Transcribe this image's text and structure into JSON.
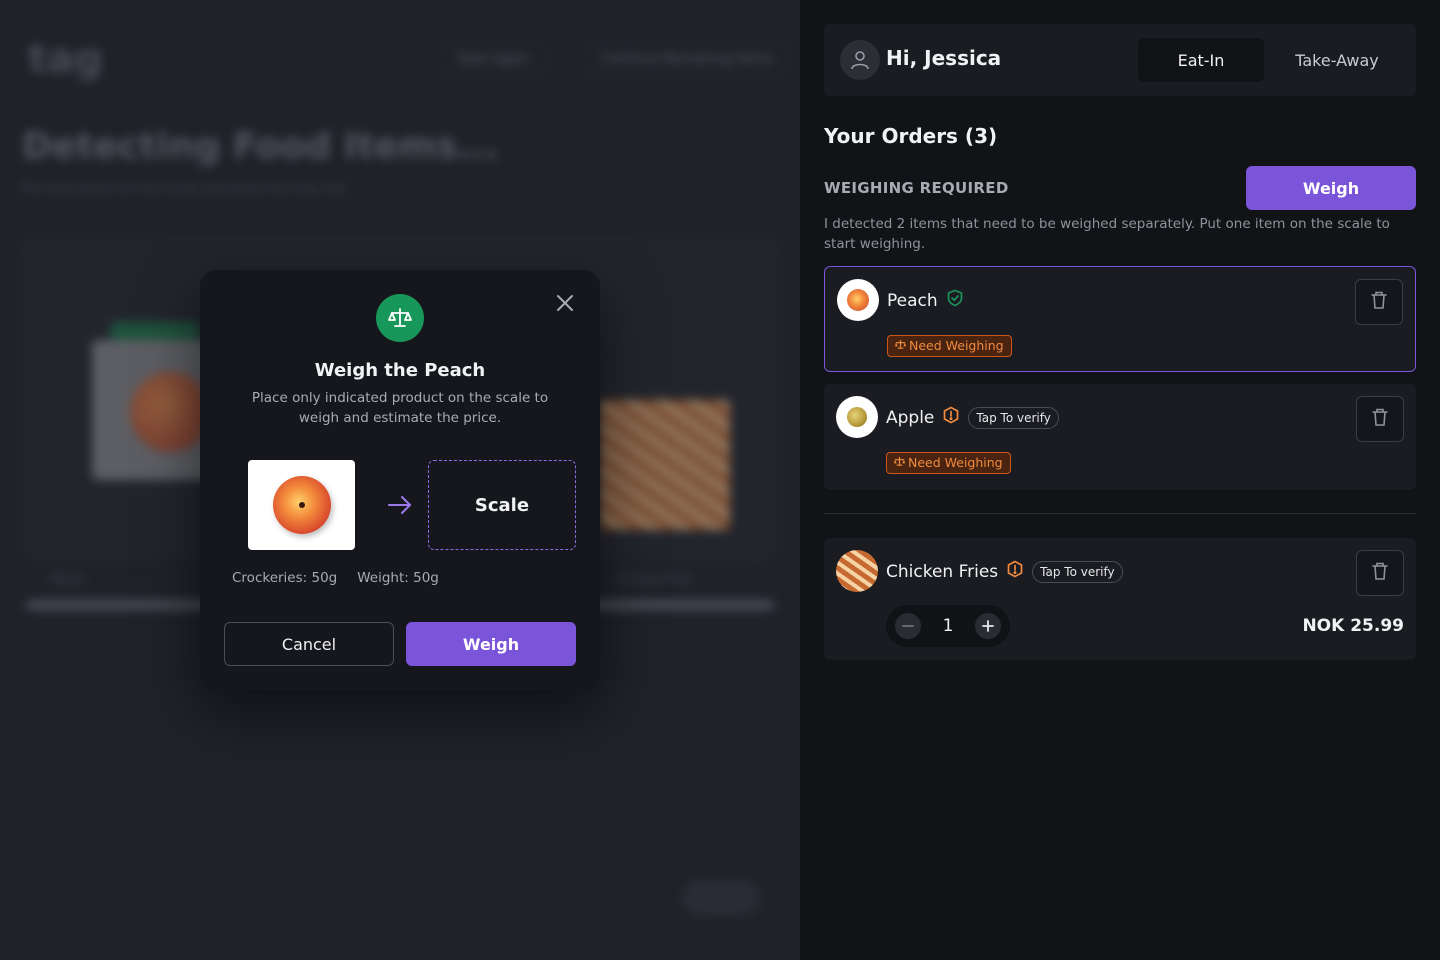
{
  "background": {
    "logo": "tag",
    "nav_pills": [
      "Start Again",
      "Continue Remaining Items"
    ],
    "title": "Detecting Food Items...",
    "subtitle": "Put food items on the scale and keep the tray still",
    "captions": [
      "Peach",
      "Chicken Fries"
    ],
    "help_button": "Help"
  },
  "modal": {
    "icon": "scale-icon",
    "title": "Weigh the Peach",
    "description": "Place only indicated product on the scale to weigh and estimate the price.",
    "scale_label": "Scale",
    "crockeries": "Crockeries: 50g",
    "weight": "Weight: 50g",
    "cancel_label": "Cancel",
    "weigh_label": "Weigh"
  },
  "header": {
    "greeting": "Hi, Jessica",
    "modes": [
      {
        "label": "Eat-In",
        "active": true
      },
      {
        "label": "Take-Away",
        "active": false
      }
    ]
  },
  "orders": {
    "title": "Your Orders (3)",
    "weighing_section": {
      "label": "WEIGHING REQUIRED",
      "weigh_button": "Weigh",
      "description": "I detected 2 items that need to be weighed separately. Put one item on the scale to start weighing."
    },
    "items": [
      {
        "name": "Peach",
        "status": "verified",
        "badge": "Need Weighing",
        "selected": true
      },
      {
        "name": "Apple",
        "status": "warning",
        "verify_chip": "Tap To verify",
        "badge": "Need Weighing"
      },
      {
        "name": "Chicken Fries",
        "status": "warning",
        "verify_chip": "Tap To verify",
        "quantity": "1",
        "price": "NOK 25.99"
      }
    ]
  },
  "colors": {
    "accent": "#7b55d9",
    "success": "#18975a",
    "warning": "#f08a3e",
    "panel": "#1b1c22",
    "background": "#121317"
  }
}
